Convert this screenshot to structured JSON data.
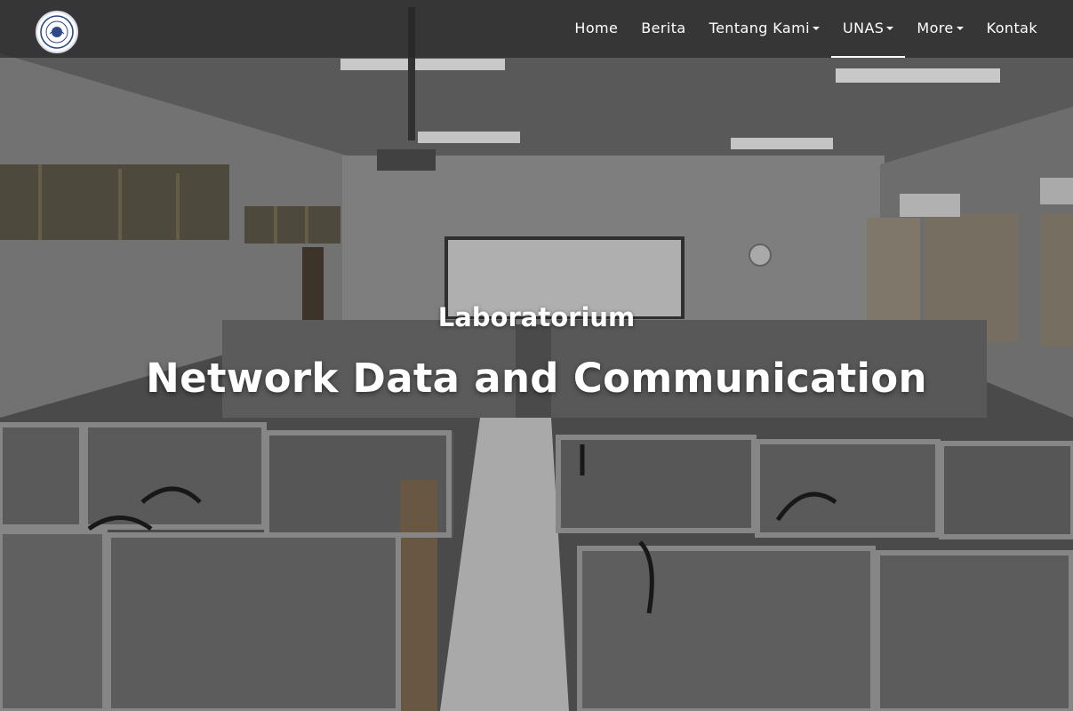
{
  "brand": {
    "logo_icon": "university-seal-icon"
  },
  "nav": {
    "items": [
      {
        "label": "Home",
        "dropdown": false,
        "active": false
      },
      {
        "label": "Berita",
        "dropdown": false,
        "active": false
      },
      {
        "label": "Tentang Kami",
        "dropdown": true,
        "active": false
      },
      {
        "label": "UNAS",
        "dropdown": true,
        "active": true
      },
      {
        "label": "More",
        "dropdown": true,
        "active": false
      },
      {
        "label": "Kontak",
        "dropdown": false,
        "active": false
      }
    ]
  },
  "hero": {
    "subtitle": "Laboratorium",
    "title": "Network Data and Communication"
  },
  "colors": {
    "nav_bg": "#282828",
    "text": "#ffffff"
  }
}
